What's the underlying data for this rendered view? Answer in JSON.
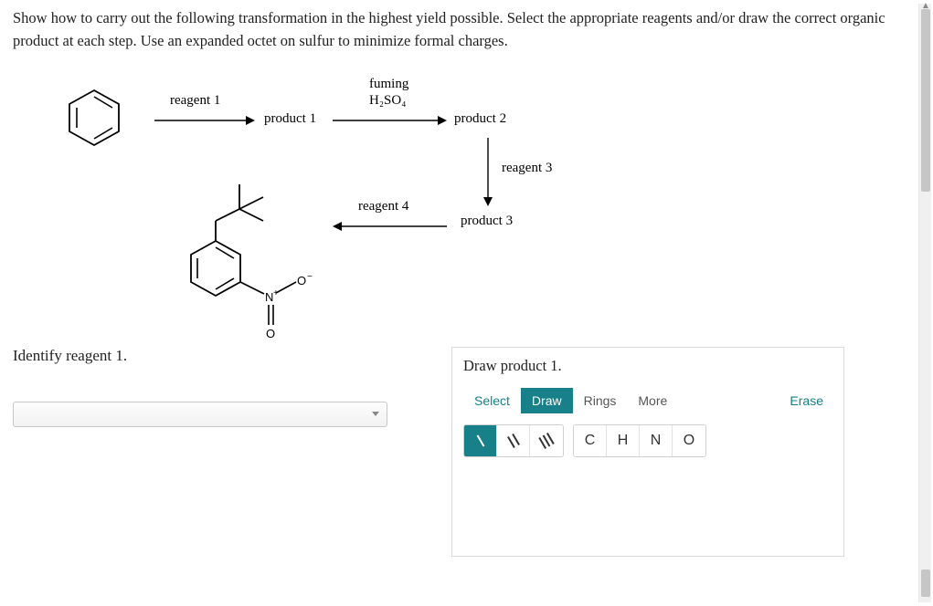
{
  "instructions": "Show how to carry out the following transformation in the highest yield possible. Select the appropriate reagents and/or draw the correct organic product at each step. Use an expanded octet on sulfur to minimize formal charges.",
  "scheme": {
    "reagent1": "reagent 1",
    "product1": "product 1",
    "fuming_line": "fuming",
    "acid_html": "H₂SO₄",
    "product2": "product 2",
    "reagent3": "reagent 3",
    "product3": "product 3",
    "reagent4": "reagent 4"
  },
  "left": {
    "prompt": "Identify reagent 1."
  },
  "right": {
    "prompt": "Draw product 1.",
    "toolbar": {
      "select": "Select",
      "draw": "Draw",
      "rings": "Rings",
      "more": "More",
      "erase": "Erase"
    },
    "atoms": {
      "c": "C",
      "h": "H",
      "n": "N",
      "o": "O"
    }
  }
}
